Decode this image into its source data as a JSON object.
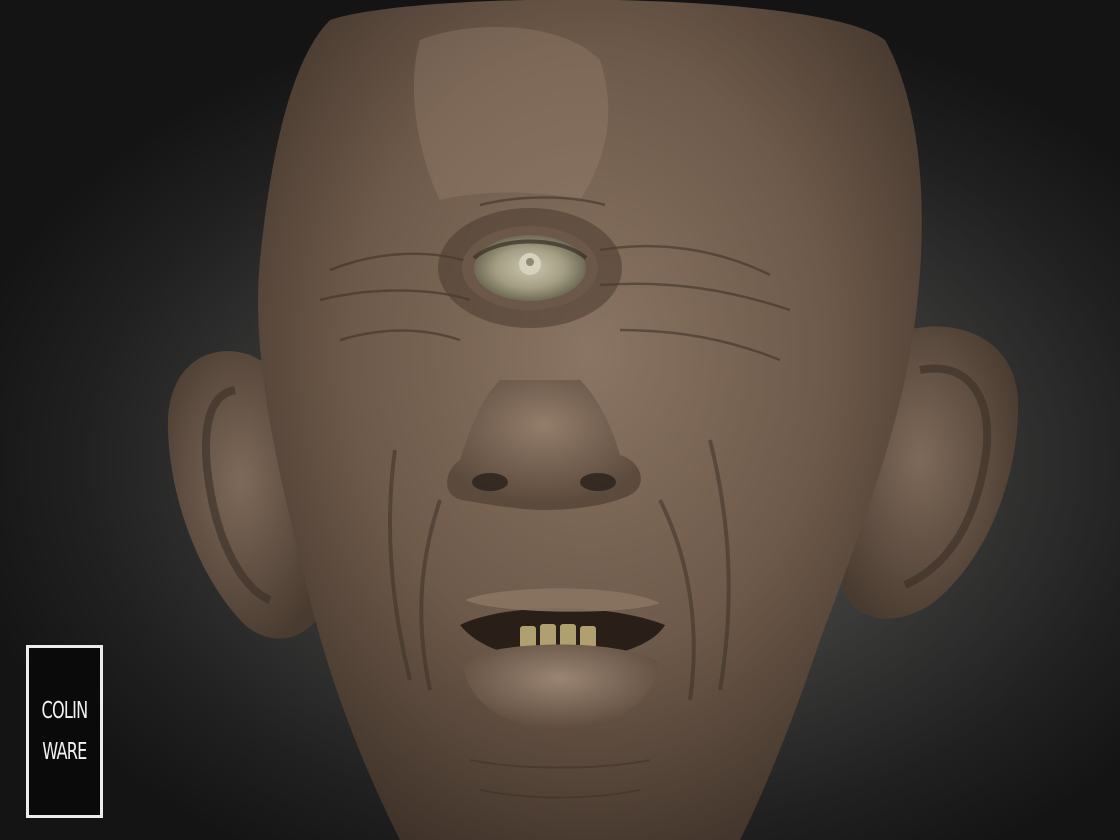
{
  "scene": {
    "subject_icon": "cyclops-head-sculpt",
    "colors": {
      "skin_light": "#8a7564",
      "skin_mid": "#6e5a4a",
      "skin_dark": "#3e3128",
      "iris": "#a49f84",
      "background_center": "#5a5a58",
      "background_edge": "#141414"
    }
  },
  "watermark": {
    "line1": "COLIN",
    "line2": "WARE",
    "border_color": "#ececec",
    "fill_color": "#0a0a0a"
  }
}
